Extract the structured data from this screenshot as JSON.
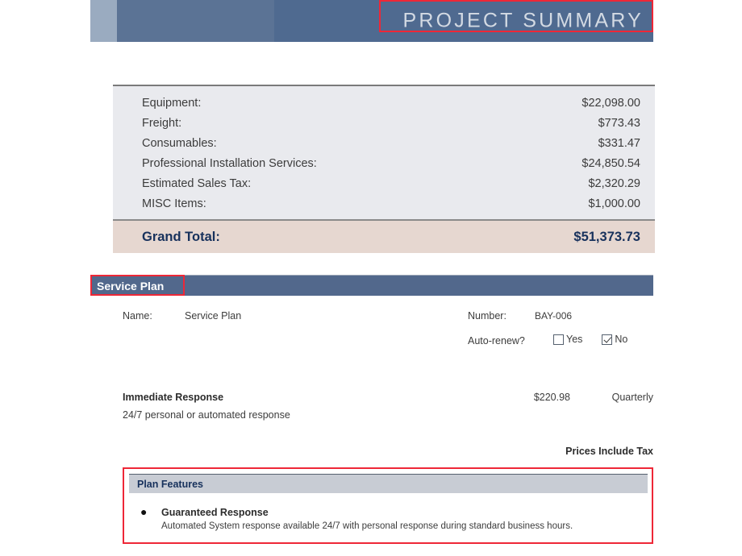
{
  "header": {
    "title": "PROJECT SUMMARY",
    "band_light_color": "#9aabc0",
    "band_mid_color": "#5b7395",
    "band_dark_color": "#4f6a90"
  },
  "totals": {
    "rows": [
      {
        "label": "Equipment:",
        "value": "$22,098.00"
      },
      {
        "label": "Freight:",
        "value": "$773.43"
      },
      {
        "label": "Consumables:",
        "value": "$331.47"
      },
      {
        "label": "Professional Installation Services:",
        "value": "$24,850.54"
      },
      {
        "label": "Estimated Sales Tax:",
        "value": "$2,320.29"
      },
      {
        "label": "MISC Items:",
        "value": "$1,000.00"
      }
    ],
    "grand_total": {
      "label": "Grand Total:",
      "value": "$51,373.73",
      "background_color": "#e6d7d0",
      "text_color": "#17315c"
    },
    "background_color": "#e9eaee"
  },
  "service_plan": {
    "section_title": "Service Plan",
    "section_bar_color": "#52688c",
    "fields": {
      "name_label": "Name:",
      "name_value": "Service Plan",
      "number_label": "Number:",
      "number_value": "BAY-006",
      "auto_renew_label": "Auto-renew?",
      "auto_renew_options": [
        {
          "label": "Yes",
          "checked": false
        },
        {
          "label": "No",
          "checked": true
        }
      ]
    },
    "item": {
      "name": "Immediate Response",
      "price": "$220.98",
      "frequency": "Quarterly",
      "description": "24/7 personal or automated response"
    },
    "prices_note": "Prices Include Tax",
    "features": {
      "header": "Plan Features",
      "header_color": "#c8ccd4",
      "entries": [
        {
          "bullet": "bullet-icon",
          "title": "Guaranteed Response",
          "description": "Automated System response available 24/7 with personal response during standard business hours."
        }
      ]
    }
  },
  "annotations": {
    "accent_color": "#ee2737",
    "boxes": [
      {
        "name": "project-summary-title"
      },
      {
        "name": "service-plan-heading"
      },
      {
        "name": "plan-features-block"
      }
    ]
  }
}
